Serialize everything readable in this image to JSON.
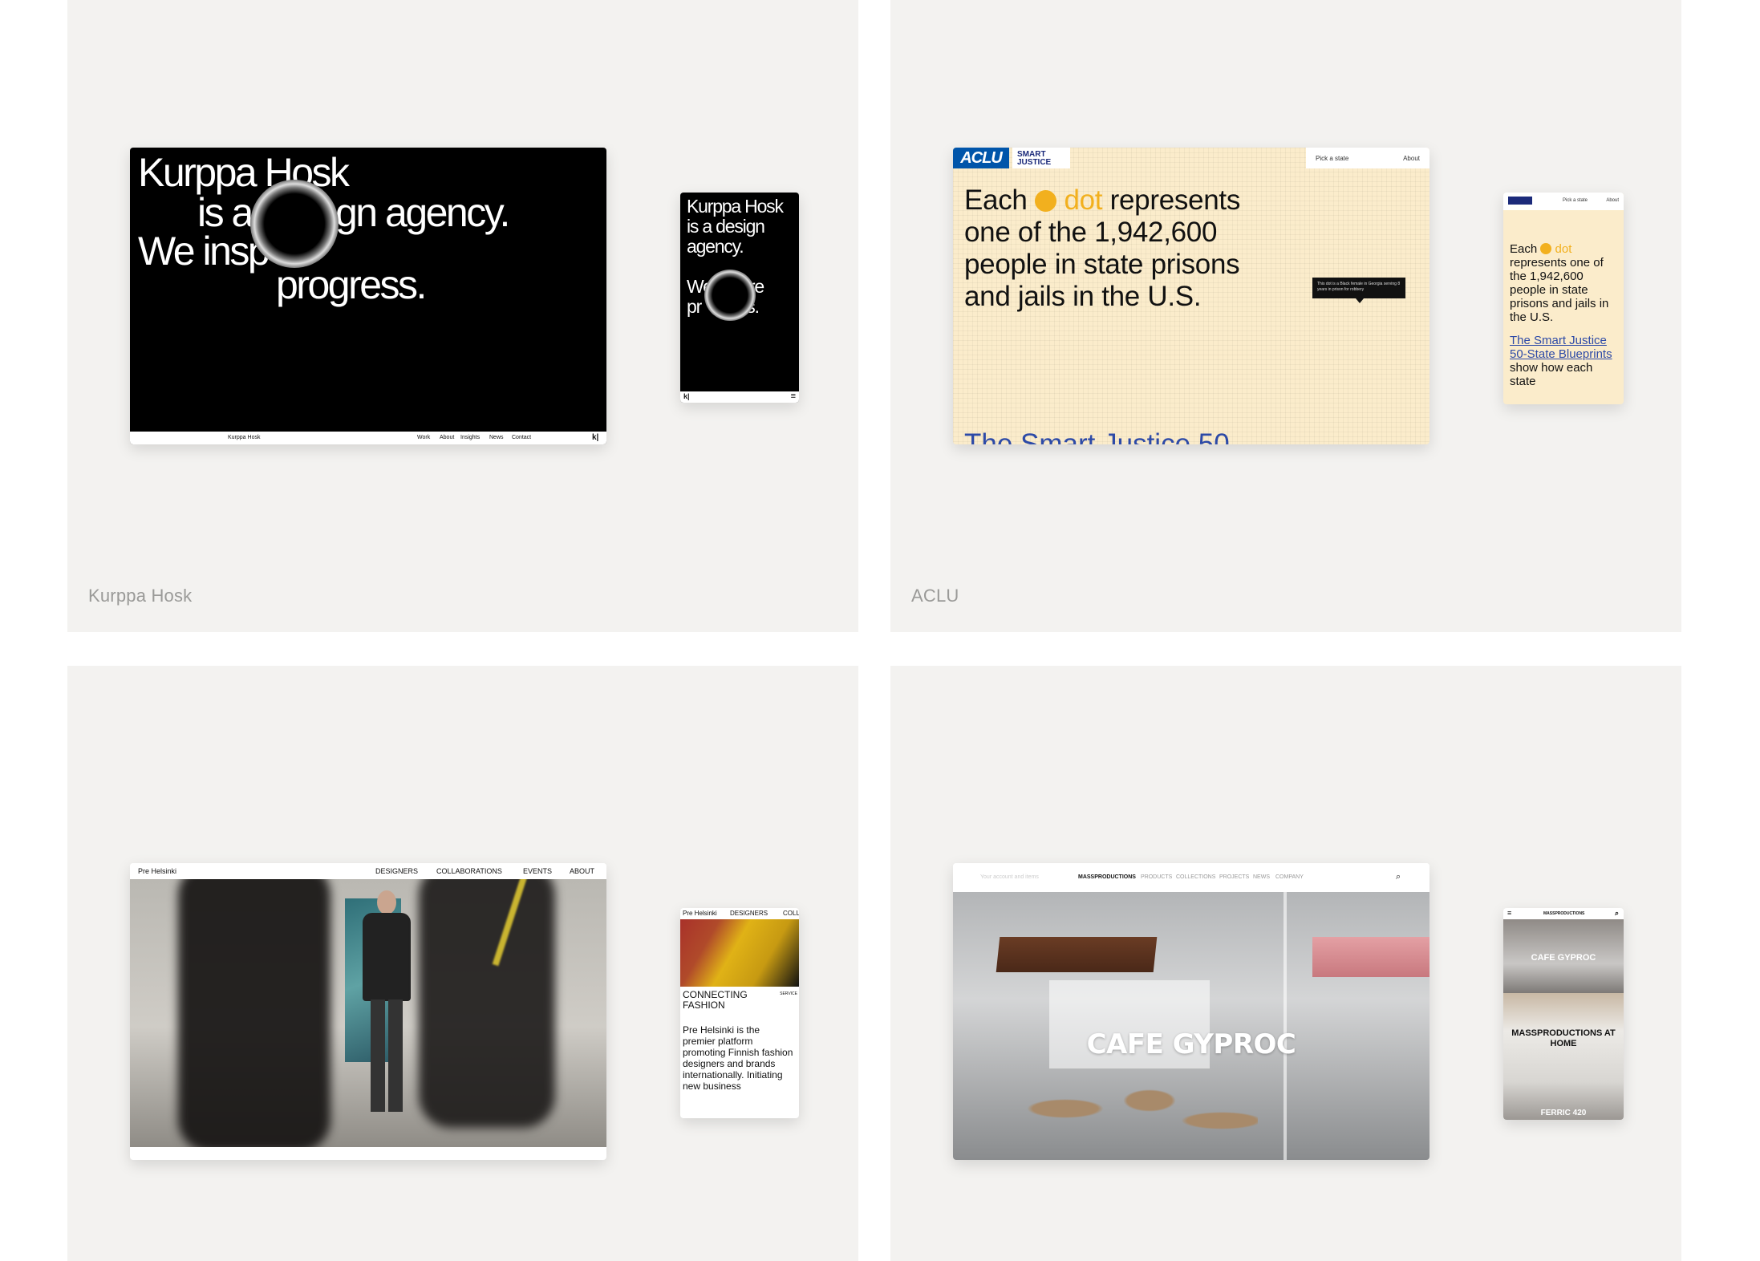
{
  "projects": [
    {
      "label": "Kurppa Hosk",
      "desktop": {
        "headline_lines": [
          "Kurppa Hosk",
          "is a",
          "gn agency.",
          "We insp",
          "progress."
        ],
        "footer_brand": "Kurppa Hosk",
        "footer_links": [
          "Work",
          "About",
          "Insights",
          "News",
          "Contact"
        ],
        "footer_mark": "k|"
      },
      "mobile": {
        "headline_lines": [
          "Kurppa Hosk",
          "is a design",
          "agency.",
          "We",
          "ire",
          "pr",
          "ss."
        ],
        "footer_mark": "k|",
        "menu_icon": "≡"
      }
    },
    {
      "label": "ACLU",
      "desktop": {
        "logo": "ACLU",
        "sub_logo": "SMART JUSTICE",
        "nav": [
          "Pick a state",
          "About"
        ],
        "headline": {
          "pre": "Each",
          "dot_word": "dot",
          "post": "represents",
          "lines": [
            "one of the 1,942,600",
            "people in state prisons",
            "and jails in the U.S."
          ]
        },
        "tooltip": "This dot is a Black female in Georgia serving 8 years in prison for robbery",
        "subheading": "The Smart Justice 50-"
      },
      "mobile": {
        "nav": [
          "Pick a state",
          "About"
        ],
        "text_pre": "Each",
        "dot_word": "dot",
        "text_post": "represents one of the 1,942,600 people in state prisons and jails in the U.S.",
        "link": "The Smart Justice 50-State Blueprints",
        "link_after": "show how each state"
      }
    },
    {
      "label": "",
      "desktop": {
        "brand": "Pre Helsinki",
        "nav": [
          "DESIGNERS",
          "COLLABORATIONS",
          "EVENTS",
          "ABOUT"
        ]
      },
      "mobile": {
        "nav": [
          "Pre Helsinki",
          "DESIGNERS",
          "COLL"
        ],
        "heading": "CONNECTING FASHION",
        "service": "SERVICE",
        "body": "Pre Helsinki is the premier platform promoting Finnish fashion designers and brands internationally. Initiating new business"
      }
    },
    {
      "label": "",
      "desktop": {
        "account": "Your account and items",
        "brand": "MASSPRODUCTIONS",
        "nav": [
          "PRODUCTS",
          "COLLECTIONS",
          "PROJECTS",
          "NEWS",
          "COMPANY"
        ],
        "search_icon": "⌕",
        "hero_title": "CAFE GYPROC"
      },
      "mobile": {
        "menu_icon": "≡",
        "brand": "MASSPRODUCTIONS",
        "search_icon": "⌕",
        "title1": "CAFE GYPROC",
        "title2": "MASSPRODUCTIONS AT HOME",
        "title3": "FERRIC 420"
      }
    }
  ]
}
